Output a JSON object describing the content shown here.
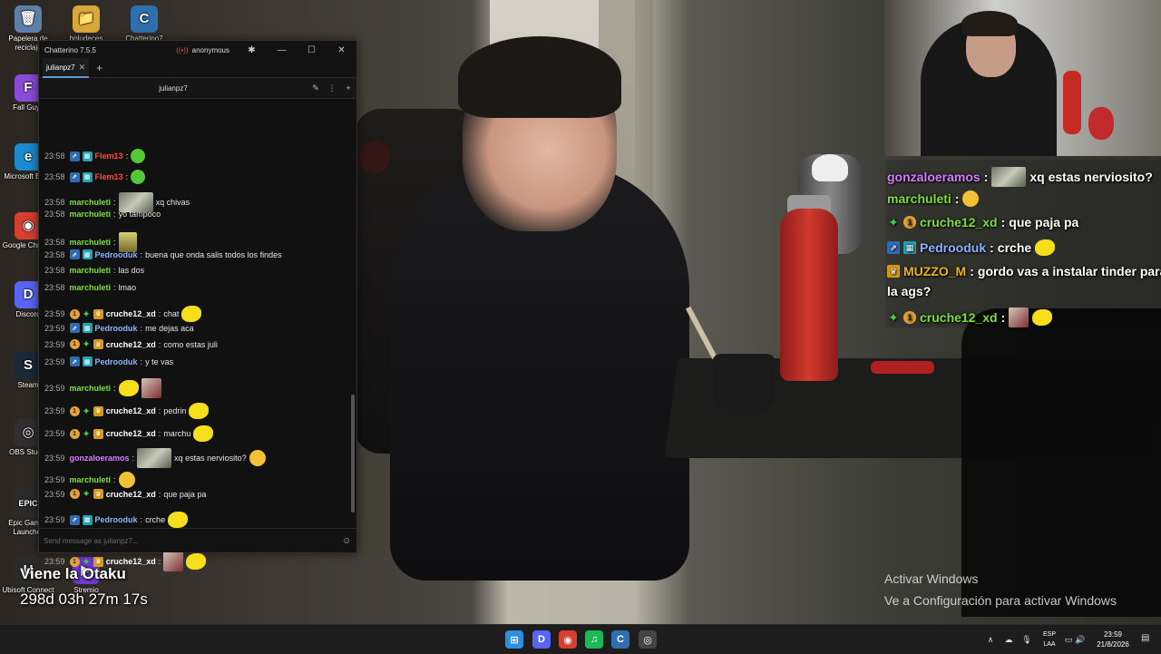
{
  "desktop": {
    "icons": [
      {
        "label": "Papelera de reciclaje",
        "glyph": "🗑",
        "color": "#5f7fa8"
      },
      {
        "label": "boludeces",
        "glyph": "📁",
        "color": "#d9a83a"
      },
      {
        "label": "Chatterino7",
        "glyph": "C",
        "color": "#2f6fb0"
      },
      {
        "label": "Fall Guys",
        "glyph": "F",
        "color": "#8a4ad8"
      },
      {
        "label": "Microsoft Edge",
        "glyph": "e",
        "color": "#1b8ad0"
      },
      {
        "label": "Google Chrome",
        "glyph": "◉",
        "color": "#d63e2f"
      },
      {
        "label": "Discord",
        "glyph": "D",
        "color": "#5865f2"
      },
      {
        "label": "Steam",
        "glyph": "S",
        "color": "#1b2838"
      },
      {
        "label": "OBS Studio",
        "glyph": "◎",
        "color": "#302e31"
      },
      {
        "label": "Epic Games Launcher",
        "glyph": "EPIC",
        "color": "#2a2a2a"
      },
      {
        "label": "Ubisoft Connect",
        "glyph": "U",
        "color": "#2a2a2a"
      },
      {
        "label": "Stremio",
        "glyph": "▶",
        "color": "#6a3ac8"
      }
    ]
  },
  "chatterino": {
    "title": "Chatterino 7.5.5",
    "account": "anonymous",
    "tab": "julianpz7",
    "channel": "julianpz7",
    "input_placeholder": "Send message as julianpz7...",
    "messages": [
      {
        "time": "23:58",
        "badges": [
          "blue",
          "teal"
        ],
        "user": "Flem13",
        "color": "#ff4b3a",
        "text": "",
        "emotes": [
          "green"
        ]
      },
      {
        "time": "23:58",
        "badges": [
          "blue",
          "teal"
        ],
        "user": "Flem13",
        "color": "#ff4b3a",
        "text": "",
        "emotes": [
          "green"
        ]
      },
      {
        "time": "23:58",
        "badges": [],
        "user": "marchuleti",
        "color": "#7dde3c",
        "text": "xq chivas",
        "emotes": [
          "pic"
        ]
      },
      {
        "time": "23:58",
        "badges": [],
        "user": "marchuleti",
        "color": "#7dde3c",
        "text": "yo tampoco",
        "emotes": []
      },
      {
        "time": "23:58",
        "badges": [],
        "user": "marchuleti",
        "color": "#7dde3c",
        "text": "",
        "emotes": [
          "sponge"
        ]
      },
      {
        "time": "23:58",
        "badges": [
          "blue",
          "teal"
        ],
        "user": "Pedrooduk",
        "color": "#8ab4ff",
        "text": "buena que onda salis todos los findes",
        "emotes": []
      },
      {
        "time": "23:58",
        "badges": [],
        "user": "marchuleti",
        "color": "#7dde3c",
        "text": "las dos",
        "emotes": []
      },
      {
        "time": "23:58",
        "badges": [],
        "user": "marchuleti",
        "color": "#7dde3c",
        "text": "lmao",
        "emotes": []
      },
      {
        "time": "23:59",
        "badges": [
          "orange",
          "spark",
          "gold"
        ],
        "user": "cruche12_xd",
        "color": "#ffffff",
        "text": "chat",
        "emotes": [
          "yellow"
        ]
      },
      {
        "time": "23:59",
        "badges": [
          "blue",
          "teal"
        ],
        "user": "Pedrooduk",
        "color": "#8ab4ff",
        "text": "me dejas aca",
        "emotes": []
      },
      {
        "time": "23:59",
        "badges": [
          "orange",
          "spark",
          "gold"
        ],
        "user": "cruche12_xd",
        "color": "#ffffff",
        "text": "como estas juli",
        "emotes": []
      },
      {
        "time": "23:59",
        "badges": [
          "blue",
          "teal"
        ],
        "user": "Pedrooduk",
        "color": "#8ab4ff",
        "text": "y te vas",
        "emotes": []
      },
      {
        "time": "23:59",
        "badges": [],
        "user": "marchuleti",
        "color": "#7dde3c",
        "text": "",
        "emotes": [
          "yellow",
          "pic2"
        ]
      },
      {
        "time": "23:59",
        "badges": [
          "orange",
          "spark",
          "gold"
        ],
        "user": "cruche12_xd",
        "color": "#ffffff",
        "text": "pedrin",
        "emotes": [
          "yellow"
        ]
      },
      {
        "time": "23:59",
        "badges": [
          "orange",
          "spark",
          "gold"
        ],
        "user": "cruche12_xd",
        "color": "#ffffff",
        "text": "marchu",
        "emotes": [
          "yellow"
        ]
      },
      {
        "time": "23:59",
        "badges": [],
        "user": "gonzaloeramos",
        "color": "#d77bff",
        "text": "xq estas nerviosito?",
        "emotes": [
          "pic",
          "think"
        ]
      },
      {
        "time": "23:59",
        "badges": [],
        "user": "marchuleti",
        "color": "#7dde3c",
        "text": "",
        "emotes": [
          "think"
        ]
      },
      {
        "time": "23:59",
        "badges": [
          "orange",
          "spark",
          "gold"
        ],
        "user": "cruche12_xd",
        "color": "#ffffff",
        "text": "que paja pa",
        "emotes": []
      },
      {
        "time": "23:59",
        "badges": [
          "blue",
          "teal"
        ],
        "user": "Pedrooduk",
        "color": "#8ab4ff",
        "text": "crche",
        "emotes": [
          "yellow"
        ]
      },
      {
        "time": "23:59",
        "badges": [
          "gold"
        ],
        "user": "MUZZO_M",
        "color": "#f0b419",
        "text": "gordo vas a instalar tinder para la ags?",
        "emotes": []
      },
      {
        "time": "23:59",
        "badges": [
          "orange",
          "spark",
          "gold"
        ],
        "user": "cruche12_xd",
        "color": "#ffffff",
        "text": "",
        "emotes": [
          "pic2",
          "yellow"
        ]
      }
    ]
  },
  "overlay_chat": [
    {
      "badges": [],
      "user": "gonzaloeramos",
      "color": "#d77bff",
      "text": "xq estas nerviosito?",
      "emotes": [
        "pic"
      ]
    },
    {
      "badges": [],
      "user": "marchuleti",
      "color": "#7dde3c",
      "text": "",
      "emotes": [
        "think"
      ]
    },
    {
      "badges": [
        "spark",
        "orange"
      ],
      "user": "cruche12_xd",
      "color": "#7dde3c",
      "text": "que paja pa",
      "emotes": []
    },
    {
      "badges": [
        "blue",
        "teal"
      ],
      "user": "Pedrooduk",
      "color": "#8ab4ff",
      "text": "crche",
      "emotes": [
        "yellow"
      ]
    },
    {
      "badges": [
        "gold"
      ],
      "user": "MUZZO_M",
      "color": "#f0b419",
      "text": "gordo vas a instalar tinder para",
      "emotes": []
    },
    {
      "badges": [],
      "user": "",
      "color": "#ffffff",
      "text": "la ags?",
      "emotes": []
    },
    {
      "badges": [
        "spark",
        "orange"
      ],
      "user": "cruche12_xd",
      "color": "#7dde3c",
      "text": "",
      "emotes": [
        "pic2",
        "yellow"
      ]
    }
  ],
  "watermark": {
    "line1": "Activar Windows",
    "line2": "Ve a Configuración para activar Windows"
  },
  "stream_overlay": {
    "title": "Viene la Otaku",
    "uptime": "298d 03h 27m 17s"
  },
  "taskbar": {
    "language": "ESP",
    "layout": "LAA",
    "time": "23:59",
    "date": "21/8/2026",
    "apps": [
      {
        "name": "start",
        "glyph": "⊞",
        "color": "#2c8fe0"
      },
      {
        "name": "discord",
        "glyph": "D",
        "color": "#5865f2"
      },
      {
        "name": "chrome",
        "glyph": "◉",
        "color": "#d63e2f"
      },
      {
        "name": "spotify",
        "glyph": "♫",
        "color": "#1db954"
      },
      {
        "name": "chatterino",
        "glyph": "C",
        "color": "#2f6fb0"
      },
      {
        "name": "obs",
        "glyph": "◎",
        "color": "#444444"
      }
    ]
  }
}
